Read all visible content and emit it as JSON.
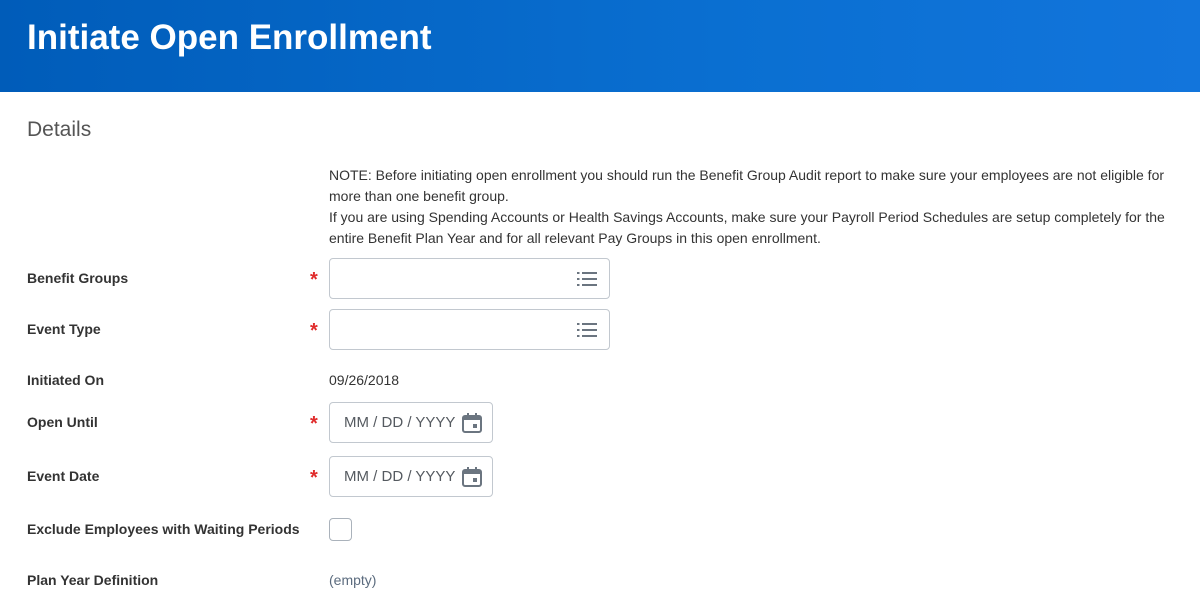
{
  "header": {
    "title": "Initiate Open Enrollment"
  },
  "section": {
    "title": "Details"
  },
  "note": {
    "line1": "NOTE: Before initiating open enrollment you should run the Benefit Group Audit report to make sure your employees are not eligible for more than one benefit group.",
    "line2": "If you are using Spending Accounts or Health Savings Accounts, make sure your Payroll Period Schedules are setup completely for the entire Benefit Plan Year and for all relevant Pay Groups in this open enrollment."
  },
  "fields": {
    "benefit_groups": {
      "label": "Benefit Groups",
      "required_mark": "*",
      "value": ""
    },
    "event_type": {
      "label": "Event Type",
      "required_mark": "*",
      "value": ""
    },
    "initiated_on": {
      "label": "Initiated On",
      "value": "09/26/2018"
    },
    "open_until": {
      "label": "Open Until",
      "required_mark": "*",
      "placeholder": "MM / DD / YYYY"
    },
    "event_date": {
      "label": "Event Date",
      "required_mark": "*",
      "placeholder": "MM / DD / YYYY"
    },
    "exclude_waiting": {
      "label": "Exclude Employees with Waiting Periods",
      "checked": false
    },
    "plan_year_definition": {
      "label": "Plan Year Definition",
      "value": "(empty)"
    }
  },
  "icons": {
    "prompt": "list-icon",
    "date": "calendar-icon"
  },
  "colors": {
    "header_start": "#005cb9",
    "header_end": "#1275dc",
    "required": "#e02c2c"
  }
}
